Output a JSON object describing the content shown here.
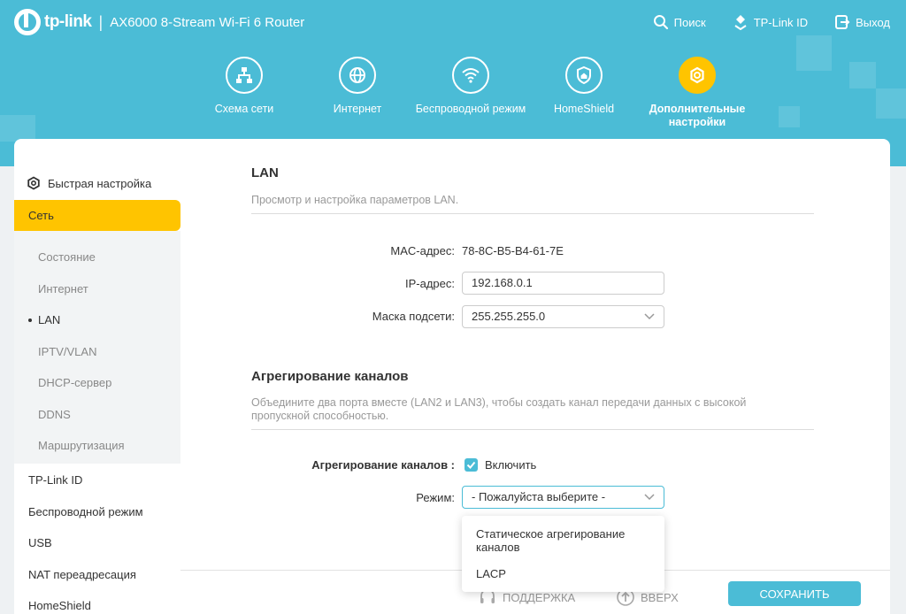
{
  "header": {
    "brand": "tp-link",
    "separator": "|",
    "model": "AX6000 8-Stream Wi-Fi 6 Router",
    "actions": [
      {
        "label": "Поиск",
        "icon": "search-icon"
      },
      {
        "label": "TP-Link ID",
        "icon": "user-icon"
      },
      {
        "label": "Выход",
        "icon": "logout-icon"
      }
    ]
  },
  "nav": {
    "items": [
      {
        "label": "Схема сети",
        "icon": "network-map-icon"
      },
      {
        "label": "Интернет",
        "icon": "globe-icon"
      },
      {
        "label": "Беспроводной режим",
        "icon": "wifi-icon"
      },
      {
        "label": "HomeShield",
        "icon": "shield-icon"
      },
      {
        "label": "Дополнительные настройки",
        "icon": "gear-icon",
        "active": true
      }
    ]
  },
  "sidebar": {
    "quick_setup": "Быстрая настройка",
    "active_section": "Сеть",
    "sub_items": [
      "Состояние",
      "Интернет",
      "LAN",
      "IPTV/VLAN",
      "DHCP-сервер",
      "DDNS",
      "Маршрутизация"
    ],
    "current_sub": "LAN",
    "items": [
      "TP-Link ID",
      "Беспроводной режим",
      "USB",
      "NAT переадресация",
      "HomeShield"
    ]
  },
  "lan": {
    "title": "LAN",
    "description": "Просмотр и настройка параметров LAN.",
    "mac_label": "MAC-адрес:",
    "mac_value": "78-8C-B5-B4-61-7E",
    "ip_label": "IP-адрес:",
    "ip_value": "192.168.0.1",
    "mask_label": "Маска подсети:",
    "mask_value": "255.255.255.0"
  },
  "aggregation": {
    "title": "Агрегирование каналов",
    "description": "Объедините два порта вместе (LAN2 и LAN3), чтобы создать канал передачи данных с высокой пропускной способностью.",
    "enable_label": "Агрегирование каналов :",
    "enable_checkbox_label": "Включить",
    "enabled": true,
    "mode_label": "Режим:",
    "mode_value": "- Пожалуйста выберите -",
    "mode_options": [
      "Статическое агрегирование каналов",
      "LACP"
    ]
  },
  "footer": {
    "support": "ПОДДЕРЖКА",
    "top": "ВВЕРХ",
    "save": "СОХРАНИТЬ"
  },
  "colors": {
    "brand_teal": "#4bbcd6",
    "accent_yellow": "#ffc400"
  }
}
